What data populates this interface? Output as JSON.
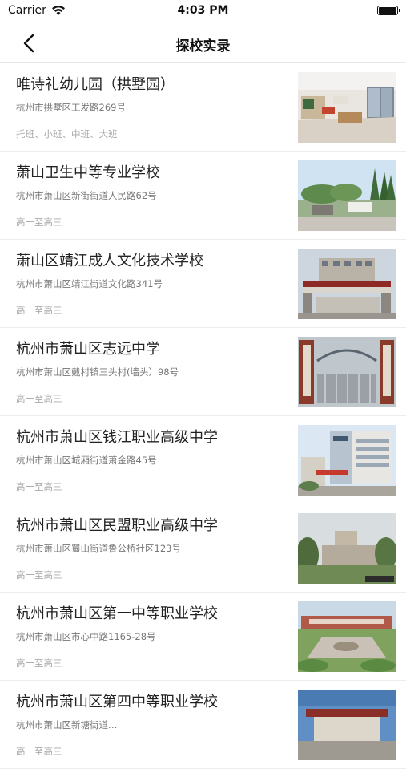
{
  "status_bar": {
    "carrier": "Carrier",
    "time": "4:03 PM"
  },
  "nav": {
    "title": "探校实录",
    "back_icon": "chevron-left-icon"
  },
  "schools": [
    {
      "name": "唯诗礼幼儿园（拱墅园）",
      "address": "杭州市拱墅区工发路269号",
      "grades": "托班、小班、中班、大班",
      "thumb": "kindergarten-interior"
    },
    {
      "name": "萧山卫生中等专业学校",
      "address": "杭州市萧山区新街街道人民路62号",
      "grades": "高一至高三",
      "thumb": "campus-trees"
    },
    {
      "name": "萧山区靖江成人文化技术学校",
      "address": "杭州市萧山区靖江街道文化路341号",
      "grades": "高一至高三",
      "thumb": "school-building"
    },
    {
      "name": "杭州市萧山区志远中学",
      "address": "杭州市萧山区戴村镇三头村(墙头）98号",
      "grades": "高一至高三",
      "thumb": "school-gate"
    },
    {
      "name": "杭州市萧山区钱江职业高级中学",
      "address": "杭州市萧山区城厢街道萧金路45号",
      "grades": "高一至高三",
      "thumb": "office-building"
    },
    {
      "name": "杭州市萧山区民盟职业高级中学",
      "address": "杭州市萧山区蜀山街道鲁公桥社区123号",
      "grades": "高一至高三",
      "thumb": "tall-building"
    },
    {
      "name": "杭州市萧山区第一中等职业学校",
      "address": "杭州市萧山区市心中路1165-28号",
      "grades": "高一至高三",
      "thumb": "aerial-campus"
    },
    {
      "name": "杭州市萧山区第四中等职业学校",
      "address": "杭州市萧山区新塘街道…",
      "grades": "高一至高三",
      "thumb": "gate-sky"
    }
  ]
}
